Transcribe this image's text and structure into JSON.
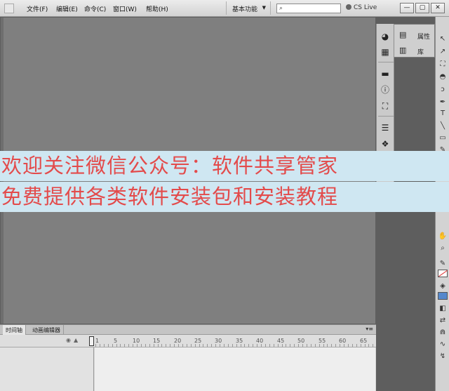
{
  "menubar": {
    "items": [
      "文件(F)",
      "编辑(E)",
      "命令(C)",
      "窗口(W)",
      "帮助(H)"
    ],
    "workspace": "基本功能",
    "search_placeholder": "",
    "cslive": "CS Live",
    "win_buttons": [
      "—",
      "▢",
      "✕"
    ]
  },
  "panels": {
    "properties_label": "属性",
    "library_label": "库"
  },
  "timeline": {
    "tabs": [
      "时间轴",
      "动画编辑器"
    ],
    "frame_numbers": [
      "1",
      "5",
      "10",
      "15",
      "20",
      "25",
      "30",
      "35",
      "40",
      "45",
      "50",
      "55",
      "60",
      "65"
    ]
  },
  "overlay": {
    "line1": "欢迎关注微信公众号：软件共享管家",
    "line2": "免费提供各类软件安装包和安装教程"
  },
  "colors": {
    "stage": "#7f7f7f",
    "banner_bg": "#cfe7f2",
    "banner_text": "#e34b4b",
    "fill_color": "#5588cc"
  }
}
